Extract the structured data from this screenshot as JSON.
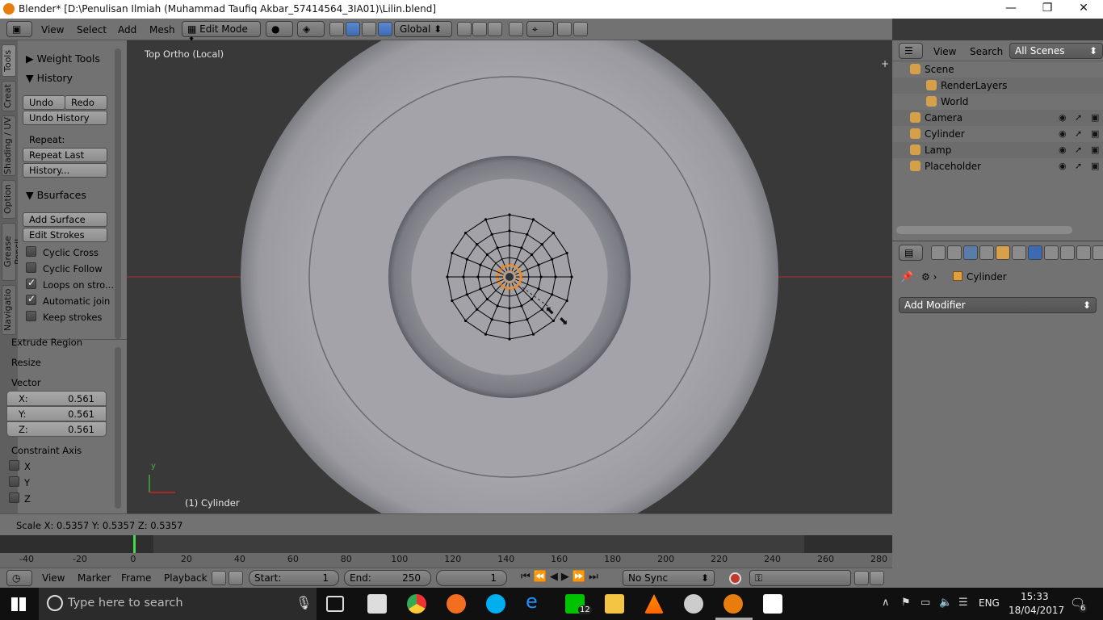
{
  "window": {
    "title": "Blender* [D:\\Penulisan Ilmiah (Muhammad Taufiq Akbar_57414564_3IA01)\\Lilin.blend]",
    "controls": [
      "—",
      "❐",
      "✕"
    ]
  },
  "header": {
    "menus": [
      "View",
      "Select",
      "Add",
      "Mesh"
    ],
    "mode": "Edit Mode",
    "orientation": "Global"
  },
  "tool_tabs": [
    "Tools",
    "Creat",
    "Shading / UV",
    "Option",
    "Grease Pencil",
    "Navigatio"
  ],
  "tool_shelf": {
    "weight_tools": "Weight Tools",
    "history": {
      "title": "History",
      "undo": "Undo",
      "redo": "Redo",
      "undo_history": "Undo History",
      "repeat_label": "Repeat:",
      "repeat_last": "Repeat Last",
      "history_btn": "History..."
    },
    "bsurfaces": {
      "title": "Bsurfaces",
      "add_surface": "Add Surface",
      "edit_strokes": "Edit Strokes",
      "options": [
        {
          "label": "Cyclic Cross",
          "checked": false
        },
        {
          "label": "Cyclic Follow",
          "checked": false
        },
        {
          "label": "Loops on stro...",
          "checked": true
        },
        {
          "label": "Automatic join",
          "checked": true
        },
        {
          "label": "Keep strokes",
          "checked": false
        }
      ]
    },
    "operator": {
      "extrude_region": "Extrude Region",
      "resize": "Resize",
      "vector_label": "Vector",
      "x_label": "X:",
      "x_val": "0.561",
      "y_label": "Y:",
      "y_val": "0.561",
      "z_label": "Z:",
      "z_val": "0.561",
      "constraint_label": "Constraint Axis",
      "axes": [
        "X",
        "Y",
        "Z"
      ]
    }
  },
  "viewport": {
    "view_name": "Top Ortho (Local)",
    "object_label": "(1) Cylinder",
    "axis_y": "y",
    "colors": {
      "mesh_light": "#a8a8ae",
      "wire": "#000000",
      "selected": "#f08a1e",
      "x_axis": "#c83232"
    }
  },
  "status": {
    "scale": "Scale X: 0.5357   Y: 0.5357   Z: 0.5357"
  },
  "timeline": {
    "ticks": [
      "-40",
      "-20",
      "0",
      "20",
      "40",
      "60",
      "80",
      "100",
      "120",
      "140",
      "160",
      "180",
      "200",
      "220",
      "240",
      "260",
      "280"
    ],
    "current_frame": 0,
    "menus": [
      "View",
      "Marker",
      "Frame",
      "Playback"
    ],
    "start_label": "Start:",
    "start_val": "1",
    "end_label": "End:",
    "end_val": "250",
    "frame_val": "1",
    "sync": "No Sync"
  },
  "outliner": {
    "menus": [
      "View",
      "Search"
    ],
    "scenes": "All Scenes",
    "items": [
      {
        "name": "Scene"
      },
      {
        "name": "RenderLayers"
      },
      {
        "name": "World"
      },
      {
        "name": "Camera"
      },
      {
        "name": "Cylinder"
      },
      {
        "name": "Lamp"
      },
      {
        "name": "Placeholder"
      }
    ]
  },
  "properties": {
    "object_name": "Cylinder",
    "add_modifier": "Add Modifier"
  },
  "taskbar": {
    "search_placeholder": "Type here to search",
    "language": "ENG",
    "time": "15:33",
    "date": "18/04/2017",
    "line_badge": "12",
    "notif_badge": "6"
  }
}
